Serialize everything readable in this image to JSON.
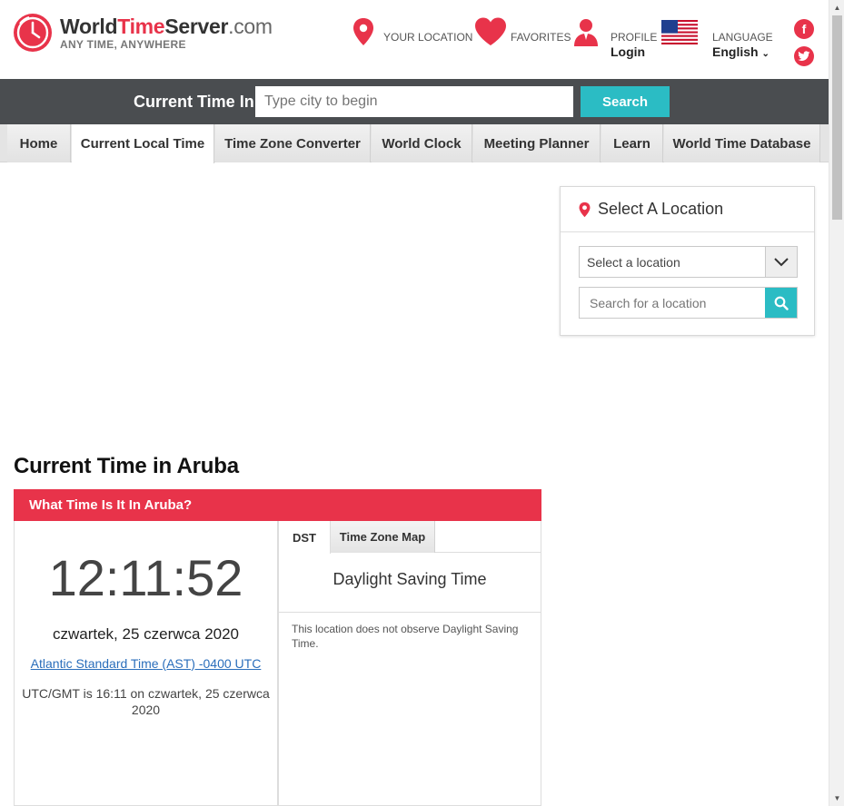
{
  "brand": {
    "part1": "World",
    "part2": "Time",
    "part3": "Server",
    "part4": ".com",
    "tagline": "ANY TIME, ANYWHERE",
    "accent_color": "#e8334a"
  },
  "header_nav": {
    "your_location": "YOUR LOCATION",
    "favorites": "FAVORITES",
    "profile": "PROFILE",
    "profile_sub": "Login",
    "language": "LANGUAGE",
    "language_sub": "English"
  },
  "social": {
    "facebook_icon": "facebook-icon",
    "twitter_icon": "twitter-icon"
  },
  "search": {
    "label": "Current Time In",
    "placeholder": "Type city to begin",
    "button": "Search",
    "button_color": "#2bbcc4"
  },
  "nav": {
    "items": [
      {
        "label": "Home"
      },
      {
        "label": "Current Local Time",
        "active": true
      },
      {
        "label": "Time Zone Converter"
      },
      {
        "label": "World Clock"
      },
      {
        "label": "Meeting Planner"
      },
      {
        "label": "Learn"
      },
      {
        "label": "World Time Database"
      }
    ]
  },
  "location_panel": {
    "title": "Select A Location",
    "select_value": "Select a location",
    "search_placeholder": "Search for a location"
  },
  "main": {
    "page_title": "Current Time in Aruba",
    "section_header": "What Time Is It In Aruba?",
    "time": "12:11:52",
    "date": "czwartek, 25 czerwca 2020",
    "timezone_link": "Atlantic Standard Time (AST) -0400 UTC",
    "utc_line": "UTC/GMT is 16:11 on czwartek, 25 czerwca 2020"
  },
  "tabs": {
    "items": [
      {
        "label": "DST",
        "active": true
      },
      {
        "label": "Time Zone Map"
      }
    ],
    "dst_title": "Daylight Saving Time",
    "dst_text": "This location does not observe Daylight Saving Time."
  }
}
